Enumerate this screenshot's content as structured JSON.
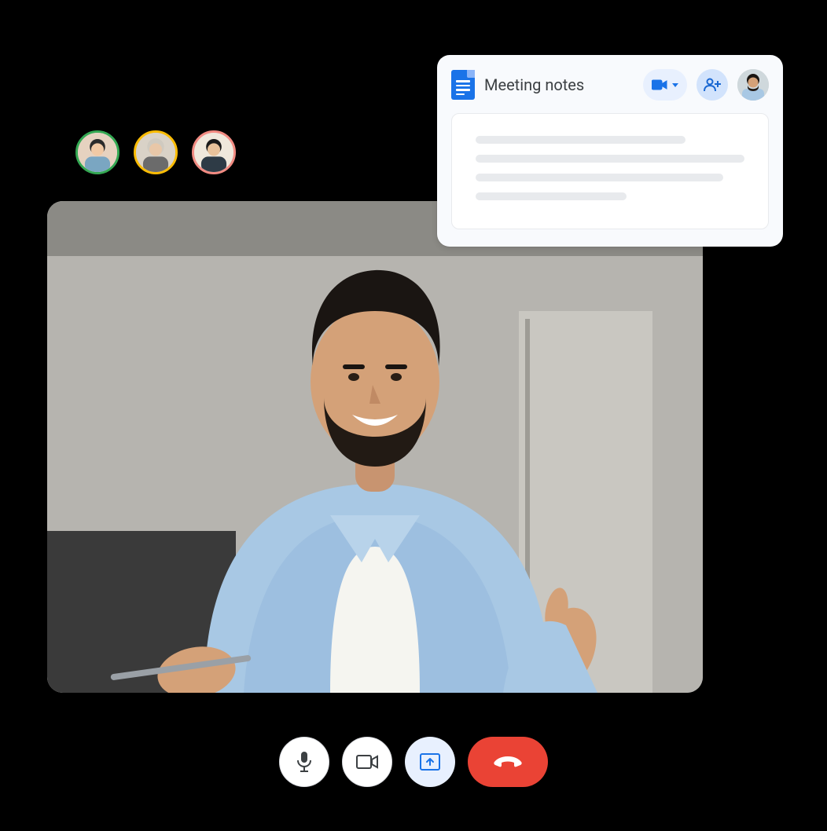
{
  "participants": [
    {
      "name": "participant-1",
      "ring": "#34a853"
    },
    {
      "name": "participant-2",
      "ring": "#fbbc04"
    },
    {
      "name": "participant-3",
      "ring": "#f28b82"
    }
  ],
  "notes": {
    "title": "Meeting notes",
    "skeleton_widths": [
      "78%",
      "100%",
      "92%",
      "56%"
    ]
  },
  "colors": {
    "primary": "#1a73e8",
    "danger": "#ea4335"
  },
  "controls": {
    "mic": "microphone",
    "camera": "camera",
    "present": "present-screen",
    "hangup": "hang-up"
  }
}
